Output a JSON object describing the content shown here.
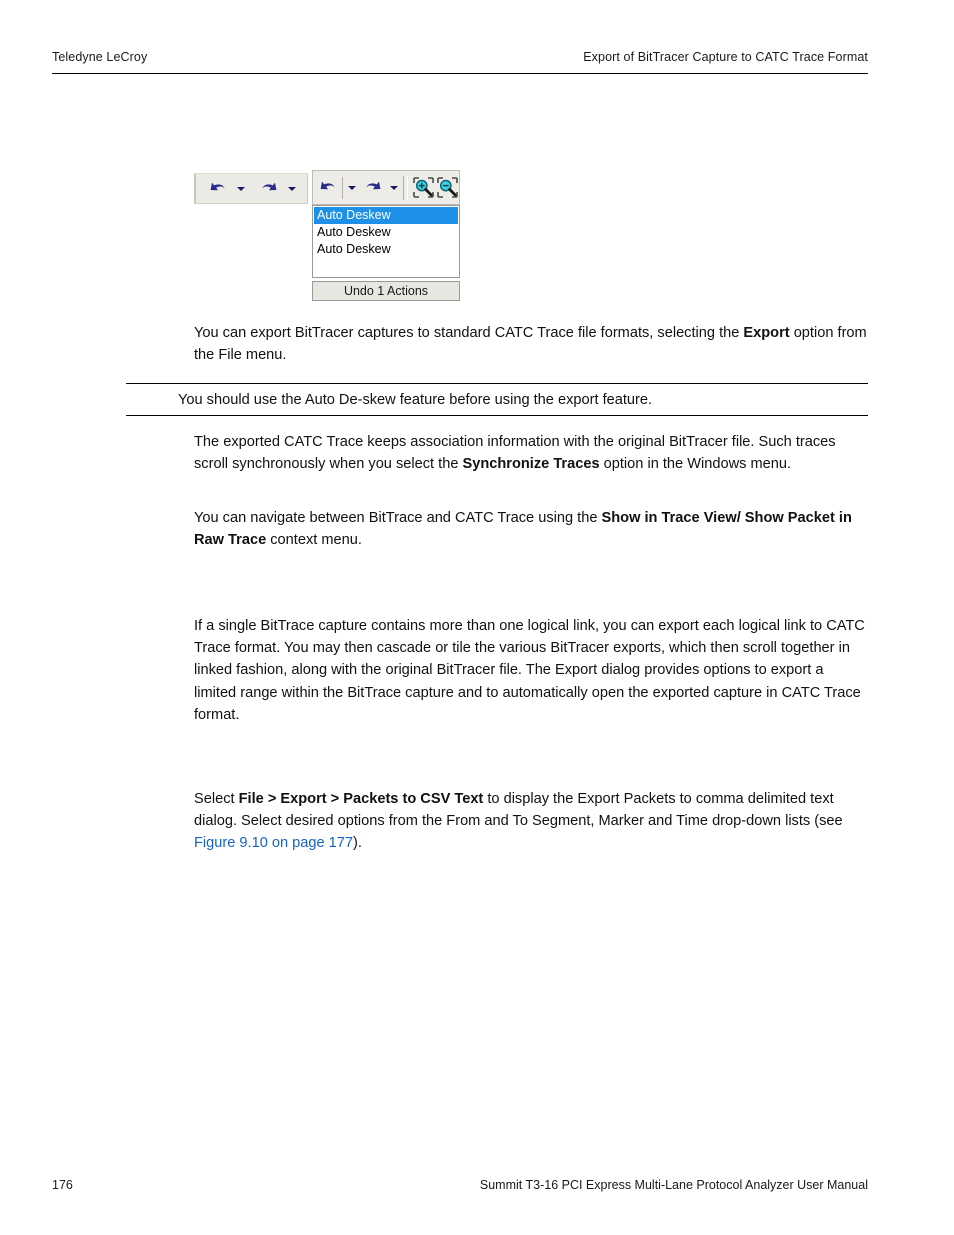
{
  "header": {
    "left": "Teledyne LeCroy",
    "right": "Export of BitTracer Capture to CATC Trace Format"
  },
  "figure": {
    "toolbar_left": {
      "undo_icon": "undo-arrow-icon",
      "undo_dropdown_icon": "chevron-down-icon",
      "redo_icon": "redo-arrow-icon",
      "redo_dropdown_icon": "chevron-down-icon"
    },
    "toolbar_right": {
      "undo_icon": "undo-arrow-icon",
      "undo_dropdown_icon": "chevron-down-icon",
      "redo_icon": "redo-arrow-icon",
      "redo_dropdown_icon": "chevron-down-icon",
      "zoom_in_icon": "zoom-in-magnifier-icon",
      "zoom_out_icon": "zoom-out-magnifier-icon"
    },
    "dropdown": {
      "items": [
        {
          "label": "Auto Deskew",
          "selected": true
        },
        {
          "label": "Auto Deskew",
          "selected": false
        },
        {
          "label": "Auto Deskew",
          "selected": false
        }
      ],
      "footer_label": "Undo 1 Actions",
      "highlight_color": "#1e90e8"
    }
  },
  "body": {
    "p1_a": "You can export BitTracer captures to standard CATC Trace file formats, selecting the ",
    "p1_b": "Export",
    "p1_c": " option from the File menu.",
    "note": "You should use the Auto De-skew feature before using the export feature.",
    "p2_a": "The exported CATC Trace keeps association information with the original BitTracer file. Such traces scroll synchronously when you select the ",
    "p2_b": "Synchronize Traces",
    "p2_c": " option in the Windows menu.",
    "p3_a": "You can navigate between BitTrace and CATC Trace using the ",
    "p3_b": "Show in Trace View/ Show Packet in Raw Trace",
    "p3_c": " context menu.",
    "p4": "If a single BitTrace capture contains more than one logical link, you can export each logical link to CATC Trace format. You may then cascade or tile the various BitTracer exports, which then scroll together in linked fashion, along with the original BitTracer file. The Export dialog provides options to export a limited range within the BitTrace capture and to automatically open the exported capture in CATC Trace format.",
    "p5_a": "Select ",
    "p5_b": "File > Export > Packets to CSV Text",
    "p5_c": " to display the Export Packets to comma delimited text dialog. Select desired options from the From and To Segment, Marker and Time drop-down lists (see ",
    "p5_link": "Figure 9.10 on page 177",
    "p5_d": ")."
  },
  "footer": {
    "page_number": "176",
    "manual_title": "Summit T3-16 PCI Express Multi-Lane Protocol Analyzer User Manual"
  }
}
